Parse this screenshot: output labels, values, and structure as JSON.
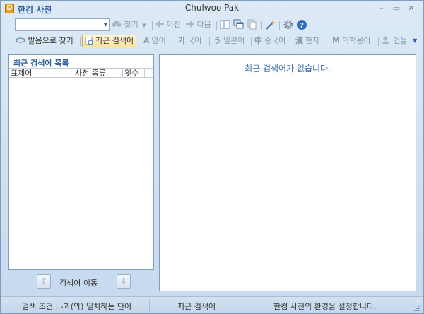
{
  "app": {
    "logo_letter": "D",
    "name": "한컴 사전",
    "window_title": "Chulwoo Pak"
  },
  "window_controls": {
    "minimize": "–",
    "maximize": "▭",
    "close": "✕"
  },
  "toolbar1": {
    "search_value": "",
    "find_label": "찾기",
    "prev_label": "이전",
    "next_label": "다음"
  },
  "toolbar2": {
    "pronounce_label": "발음으로 찾기",
    "recent_label": "최근 검색어",
    "tabs": [
      {
        "glyph": "A",
        "label": "영어"
      },
      {
        "glyph": "가",
        "label": "국어"
      },
      {
        "glyph": "う",
        "label": "일본어"
      },
      {
        "glyph": "中",
        "label": "중국어"
      },
      {
        "glyph": "漢",
        "label": "한자"
      },
      {
        "glyph": "M",
        "label": "의학용어"
      },
      {
        "glyph": "",
        "label": "인물"
      }
    ],
    "more": "▼"
  },
  "left_panel": {
    "title": "최근 검색어 목록",
    "columns": [
      "표제어",
      "사전 종류",
      "횟수"
    ]
  },
  "nav": {
    "label": "검색어 이동",
    "up": "⇧",
    "down": "⇩"
  },
  "right_panel": {
    "empty_message": "최근 검색어가 없습니다."
  },
  "status": {
    "condition": "검색 조건 : -과(와) 일치하는 단어",
    "mode": "최근 검색어",
    "hint": "한컴 사전의 환경을 설정합니다."
  }
}
